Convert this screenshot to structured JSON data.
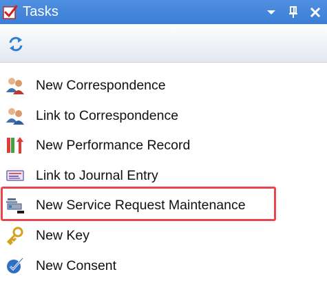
{
  "window": {
    "title": "Tasks",
    "title_icon": "tasks-checkbox-icon",
    "controls": [
      {
        "name": "dropdown-arrow-icon"
      },
      {
        "name": "pin-icon"
      },
      {
        "name": "close-icon"
      }
    ]
  },
  "toolbar": {
    "refresh_icon": "refresh-icon"
  },
  "tasks": [
    {
      "label": "New Correspondence",
      "icon": "people-icon"
    },
    {
      "label": "Link to Correspondence",
      "icon": "people-link-icon"
    },
    {
      "label": "New Performance Record",
      "icon": "performance-icon"
    },
    {
      "label": "Link to Journal Entry",
      "icon": "journal-icon"
    },
    {
      "label": "New Service Request Maintenance",
      "icon": "service-request-icon",
      "highlighted": true
    },
    {
      "label": "New Key",
      "icon": "key-icon"
    },
    {
      "label": "New Consent",
      "icon": "consent-check-icon"
    }
  ],
  "colors": {
    "titlebar": "#3b7ed6",
    "highlight_border": "#e8454e"
  }
}
